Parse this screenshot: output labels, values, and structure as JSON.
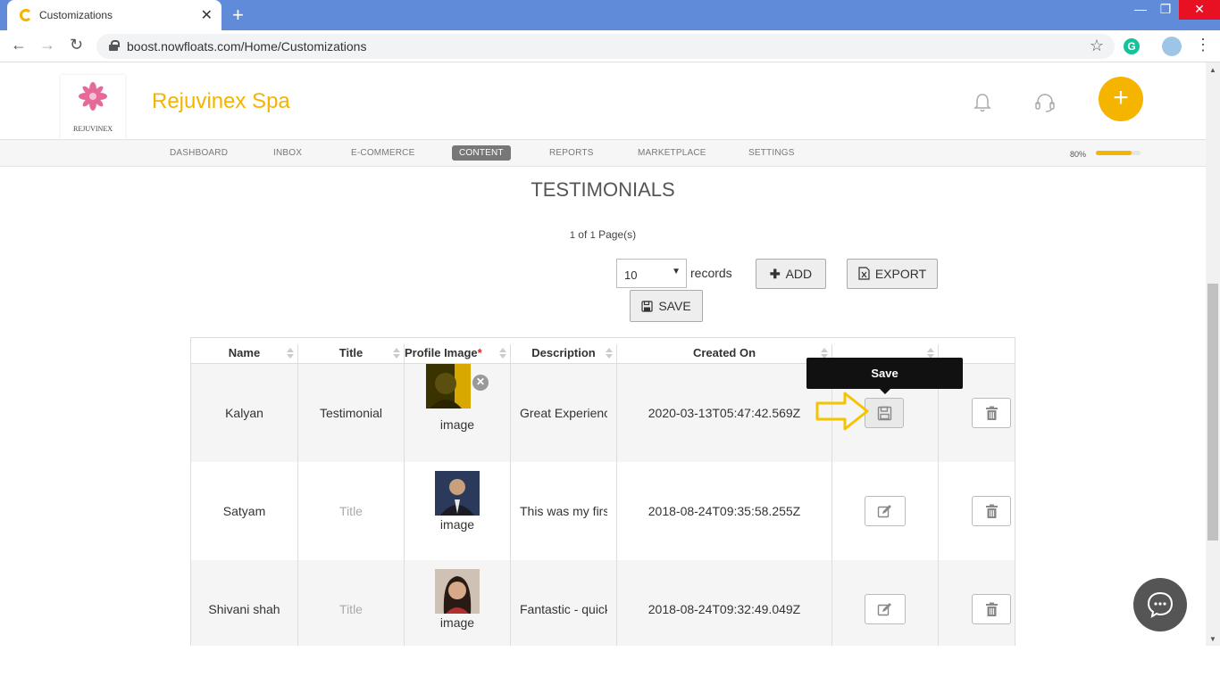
{
  "browser": {
    "tab_title": "Customizations",
    "url": "boost.nowfloats.com/Home/Customizations",
    "extension_letter": "G"
  },
  "header": {
    "logo_text": "REJUVINEX",
    "business_name": "Rejuvinex Spa",
    "accent_color": "#f5b400"
  },
  "nav": {
    "items": [
      "DASHBOARD",
      "INBOX",
      "E-COMMERCE",
      "CONTENT",
      "REPORTS",
      "MARKETPLACE",
      "SETTINGS"
    ],
    "active": "CONTENT",
    "progress_label": "80%",
    "progress_value": 0.8
  },
  "page": {
    "title": "TESTIMONIALS",
    "pager_current": "1",
    "pager_of": " of ",
    "pager_total": "1",
    "pager_suffix": " Page(s)",
    "records_value": "10",
    "records_label": "records",
    "add_label": "ADD",
    "export_label": "EXPORT",
    "save_label": "SAVE"
  },
  "table": {
    "columns": [
      "Name",
      "Title",
      "Profile Image",
      "Description",
      "Created On",
      "",
      ""
    ],
    "image_caption": "image",
    "title_placeholder": "Title",
    "rows": [
      {
        "name": "Kalyan",
        "title": "Testimonial",
        "description": "Great Experience",
        "created_on": "2020-03-13T05:47:42.569Z"
      },
      {
        "name": "Satyam",
        "title": "",
        "description": "This was my first",
        "created_on": "2018-08-24T09:35:58.255Z"
      },
      {
        "name": "Shivani shah",
        "title": "",
        "description": "Fantastic - quick",
        "created_on": "2018-08-24T09:32:49.049Z"
      }
    ]
  },
  "tooltip": {
    "text": "Save"
  }
}
